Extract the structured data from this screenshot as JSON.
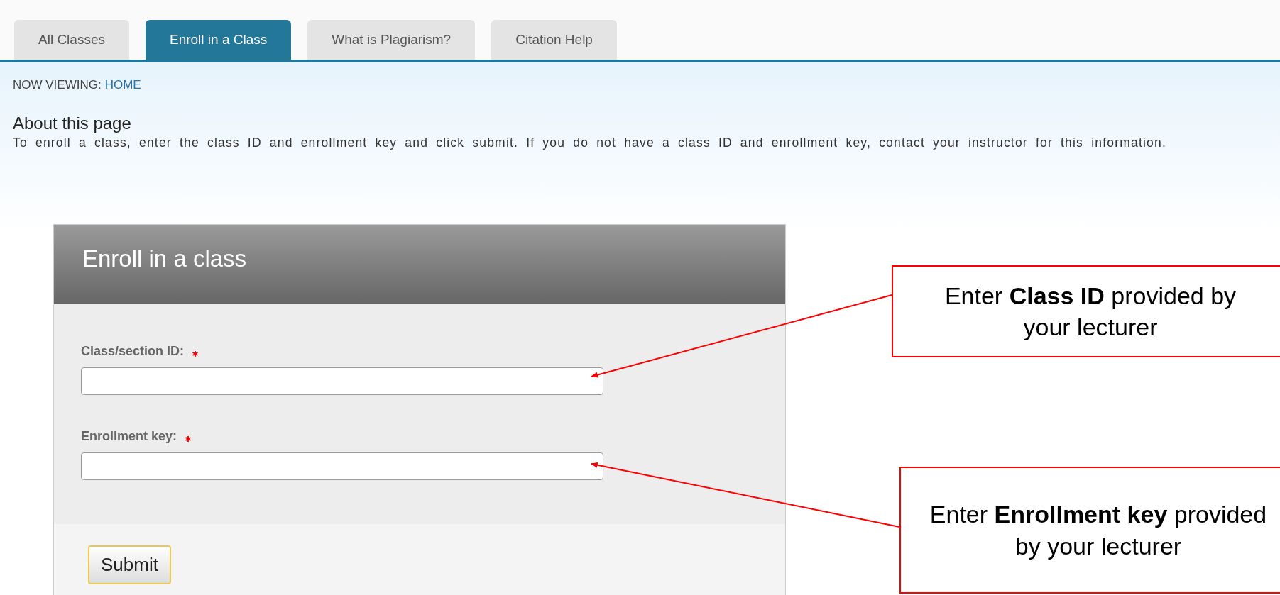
{
  "tabs": [
    {
      "label": "All Classes",
      "selected": false
    },
    {
      "label": "Enroll in a Class",
      "selected": true
    },
    {
      "label": "What is Plagiarism?",
      "selected": false
    },
    {
      "label": "Citation Help",
      "selected": false
    }
  ],
  "breadcrumb": {
    "label": "NOW VIEWING:",
    "location": "HOME"
  },
  "about": {
    "title": "About this page",
    "text": "To enroll a class, enter the class ID and enrollment key and click submit. If you do not have a class ID and enrollment key, contact your instructor for this information."
  },
  "form": {
    "title": "Enroll in a class",
    "fields": [
      {
        "label": "Class/section ID:",
        "required": true
      },
      {
        "label": "Enrollment key:",
        "required": true
      }
    ],
    "submit": "Submit"
  },
  "annotations": [
    {
      "text": "Enter **Class ID** provided by your lecturer"
    },
    {
      "text": "Enter **Enrollment key** provided by your lecturer"
    }
  ]
}
